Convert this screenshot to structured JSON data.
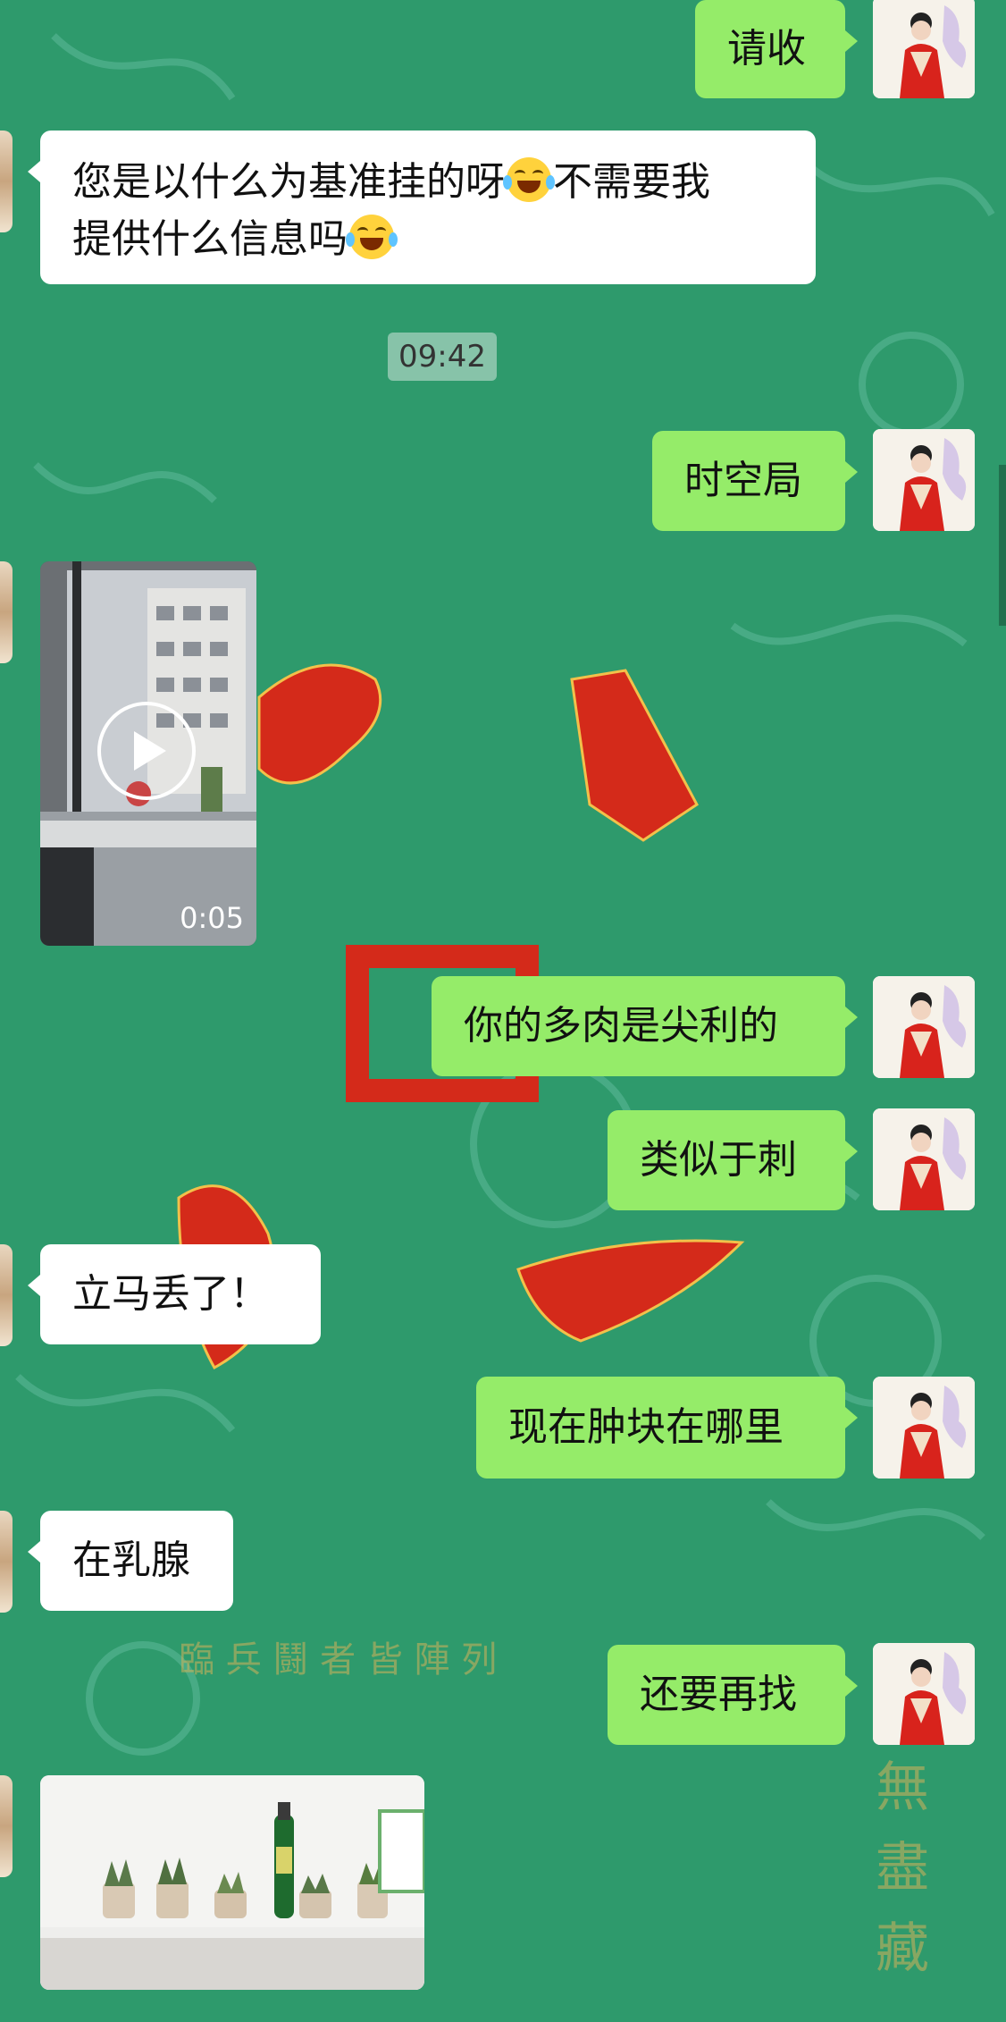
{
  "messages": {
    "m1": "请收",
    "m2_part1": "您是以什么为基准挂的呀",
    "m2_part2": "不需要我",
    "m2_part3": "提供什么信息吗",
    "timestamp": "09:42",
    "m3": "时空局",
    "video_duration": "0:05",
    "m4": "你的多肉是尖利的",
    "m5": "类似于刺",
    "m6": "立马丢了！",
    "m7": "现在肿块在哪里",
    "m8": "在乳腺",
    "m9": "还要再找"
  },
  "colors": {
    "background": "#2e9a6c",
    "outgoing_bubble": "#95ec69",
    "incoming_bubble": "#ffffff"
  },
  "icons": [
    "laughing-crying-emoji",
    "play-icon"
  ]
}
